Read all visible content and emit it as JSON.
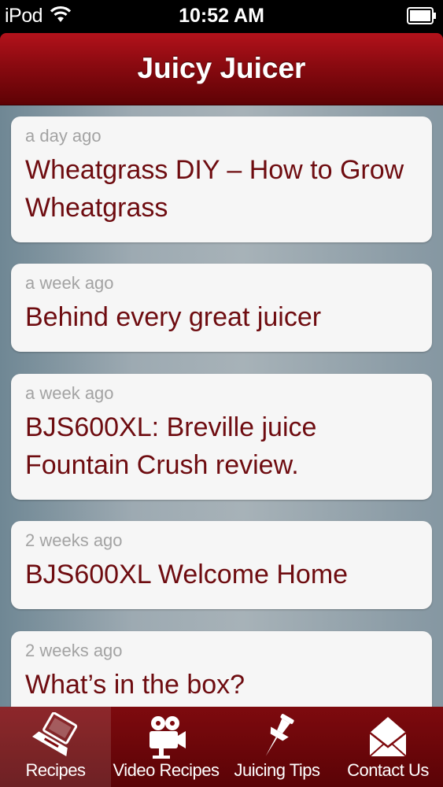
{
  "status_bar": {
    "carrier": "iPod",
    "time": "10:52 AM",
    "wifi_icon": "wifi-icon",
    "battery_icon": "battery-icon"
  },
  "header": {
    "title": "Juicy Juicer"
  },
  "posts": [
    {
      "time_ago": "a day ago",
      "title": "Wheatgrass DIY – How to Grow Wheatgrass"
    },
    {
      "time_ago": "a week ago",
      "title": "Behind every great juicer"
    },
    {
      "time_ago": "a week ago",
      "title": "BJS600XL: Breville juice Fountain Crush review."
    },
    {
      "time_ago": "2 weeks ago",
      "title": "BJS600XL Welcome Home"
    },
    {
      "time_ago": "2 weeks ago",
      "title": "What’s in the box?"
    }
  ],
  "tabs": [
    {
      "label": "Recipes",
      "icon": "laptop-icon",
      "selected": true
    },
    {
      "label": "Video Recipes",
      "icon": "video-camera-icon",
      "selected": false
    },
    {
      "label": "Juicing Tips",
      "icon": "pushpin-icon",
      "selected": false
    },
    {
      "label": "Contact Us",
      "icon": "envelope-icon",
      "selected": false
    }
  ],
  "colors": {
    "header_red": "#8a0a10",
    "headline_text": "#6e0c10",
    "time_text": "#a3a3a3",
    "card_bg": "#f6f6f6"
  }
}
